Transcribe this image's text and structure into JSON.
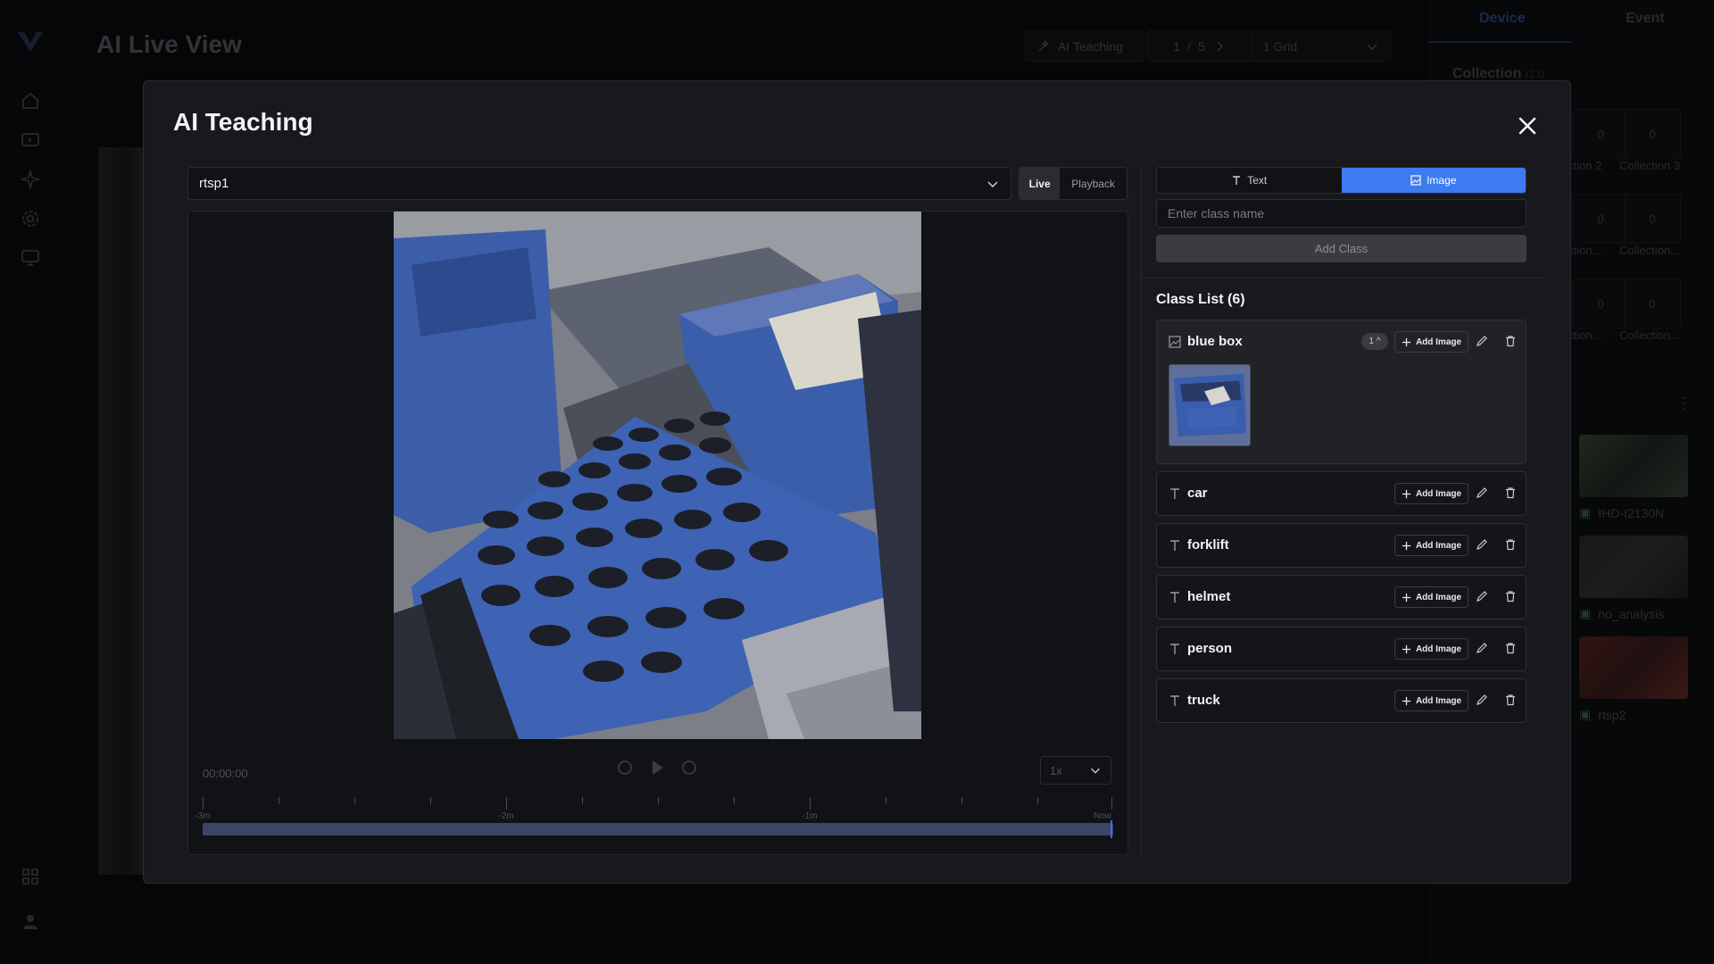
{
  "app": {
    "page_title": "AI Live View",
    "header": {
      "ai_teaching_label": "AI Teaching",
      "page_current": "1",
      "page_separator": "/",
      "page_total": "5",
      "grid_select": "1 Grid"
    },
    "side": {
      "tabs": [
        "Device",
        "Event"
      ],
      "collection_title": "Collection",
      "collection_count": "(13)",
      "collections": [
        {
          "count": "0",
          "label": "ction 2"
        },
        {
          "count": "0",
          "label": "Collection 3"
        },
        {
          "count": "0",
          "label": "ction..."
        },
        {
          "count": "0",
          "label": "Collection..."
        },
        {
          "count": "0",
          "label": "ction..."
        },
        {
          "count": "0",
          "label": "Collection..."
        }
      ],
      "cameras": [
        "IHD-I2130N",
        "no_analysis",
        "rtsp2"
      ]
    }
  },
  "modal": {
    "title": "AI Teaching",
    "source": "rtsp1",
    "modes": [
      "Live",
      "Playback"
    ],
    "player": {
      "time": "00:00:00",
      "speed": "1x",
      "timeline_labels": [
        "-3m",
        "-2m",
        "-1m",
        "Now"
      ]
    },
    "type_tabs": [
      "Text",
      "Image"
    ],
    "class_input_placeholder": "Enter class name",
    "add_class_label": "Add Class",
    "class_list_title": "Class List (6)",
    "add_image_label": "Add Image",
    "classes": [
      {
        "name": "blue box",
        "type": "image",
        "image_count": "1"
      },
      {
        "name": "car",
        "type": "text"
      },
      {
        "name": "forklift",
        "type": "text"
      },
      {
        "name": "helmet",
        "type": "text"
      },
      {
        "name": "person",
        "type": "text"
      },
      {
        "name": "truck",
        "type": "text"
      }
    ]
  },
  "colors": {
    "accent": "#3d7bf0",
    "modal_bg": "#18191c",
    "timeline_track": "#3a4567"
  }
}
